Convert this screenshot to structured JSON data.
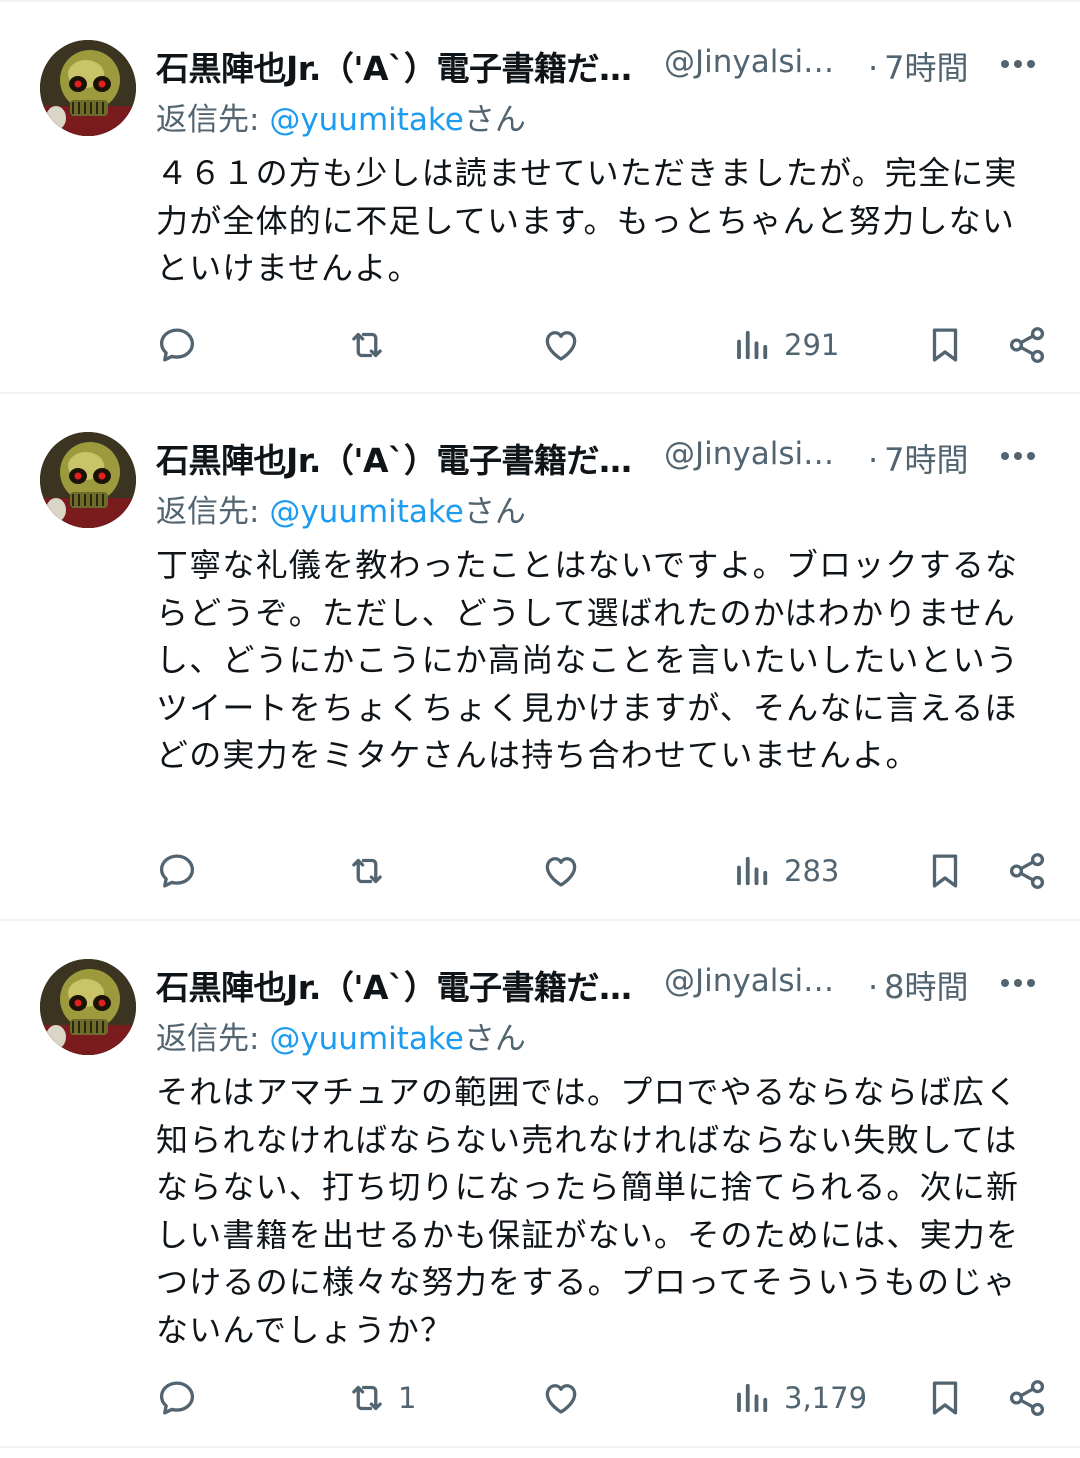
{
  "colors": {
    "text": "#0f1419",
    "secondary": "#536471",
    "link": "#1d9bf0",
    "divider": "#eff3f4"
  },
  "icons": {
    "reply": "speech-bubble-icon",
    "retweet": "retweet-arrows-icon",
    "like": "heart-icon",
    "views": "bar-chart-icon",
    "bookmark": "bookmark-icon",
    "share": "share-nodes-icon",
    "more": "ellipsis-icon"
  },
  "tweets": [
    {
      "display_name": "石黒陣也Jr.（'A`）電子書籍だ…",
      "handle": "@Jinyalsi…",
      "time_dot": "·",
      "time": "7時間",
      "reply_label": "返信先: ",
      "reply_mention": "@yuumitake",
      "reply_suffix": "さん",
      "text": "４６１の方も少しは読ませていただきましたが。完全に実力が全体的に不足しています。もっとちゃんと努力しないといけませんよ。",
      "replies": "",
      "retweets": "",
      "likes": "",
      "views": "291"
    },
    {
      "display_name": "石黒陣也Jr.（'A`）電子書籍だ…",
      "handle": "@Jinyalsi…",
      "time_dot": "·",
      "time": "7時間",
      "reply_label": "返信先: ",
      "reply_mention": "@yuumitake",
      "reply_suffix": "さん",
      "text": "丁寧な礼儀を教わったことはないですよ。ブロックするならどうぞ。ただし、どうして選ばれたのかはわかりませんし、どうにかこうにか高尚なことを言いたいしたいというツイートをちょくちょく見かけますが、そんなに言えるほどの実力をミタケさんは持ち合わせていませんよ。",
      "replies": "",
      "retweets": "",
      "likes": "",
      "views": "283"
    },
    {
      "display_name": "石黒陣也Jr.（'A`）電子書籍だ…",
      "handle": "@Jinyalsi…",
      "time_dot": "·",
      "time": "8時間",
      "reply_label": "返信先: ",
      "reply_mention": "@yuumitake",
      "reply_suffix": "さん",
      "text": "それはアマチュアの範囲では。プロでやるならならば広く知られなければならない売れなければならない失敗してはならない、打ち切りになったら簡単に捨てられる。次に新しい書籍を出せるかも保証がない。そのためには、実力をつけるのに様々な努力をする。プロってそういうものじゃないんでしょうか？",
      "replies": "",
      "retweets": "1",
      "likes": "",
      "views": "3,179"
    }
  ]
}
